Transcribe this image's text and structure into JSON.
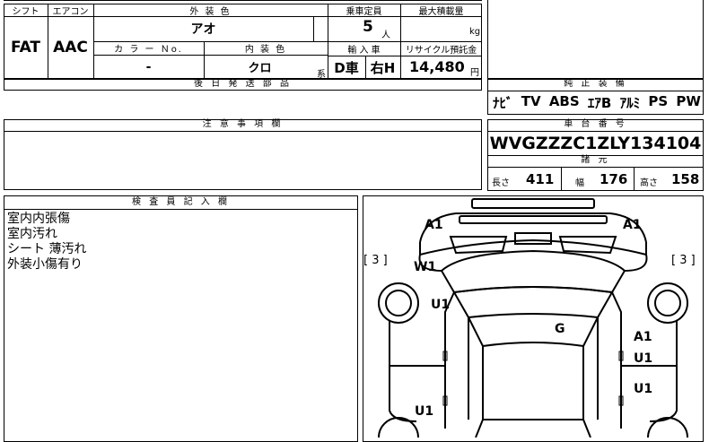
{
  "spec_table": {
    "shift_label": "シフト",
    "shift_value": "FAT",
    "aircon_label": "エアコン",
    "aircon_value": "AAC",
    "exterior_color_label": "外 装 色",
    "exterior_color_value": "アオ",
    "color_no_label": "カ ラ ー Ｎo.",
    "color_no_value": "-",
    "interior_color_label": "内 装 色",
    "interior_color_value": "クロ",
    "interior_suffix": "系",
    "capacity_label": "乗車定員",
    "capacity_value": "5",
    "capacity_unit": "人",
    "max_load_label": "最大積載量",
    "max_load_unit": "kg",
    "import_label": "輸 入 車",
    "import_value": "D車",
    "steering_value": "右H",
    "recycle_label": "リサイクル預託金",
    "recycle_value": "14,480",
    "recycle_unit": "円"
  },
  "later_parts": {
    "label": "後 日 発 送 部 品"
  },
  "genuine_equipment": {
    "label": "純 正 装 備",
    "items": [
      "ﾅﾋﾞ",
      "TV",
      "ABS",
      "ｴｱB",
      "ｱﾙﾐ",
      "PS",
      "PW"
    ]
  },
  "notes_section": {
    "label": "注 意 事 項 欄"
  },
  "chassis": {
    "label": "車 台 番 号",
    "number": "WVGZZZC1ZLY134104",
    "specs_label": "諸 元",
    "length_label": "長さ",
    "length_value": "411",
    "width_label": "幅",
    "width_value": "176",
    "height_label": "高さ",
    "height_value": "158"
  },
  "inspector": {
    "label": "検 査 員 記 入 欄",
    "lines": [
      "室内内張傷",
      "室内汚れ",
      "シート 薄汚れ",
      "外装小傷有り"
    ]
  },
  "diagram": {
    "left_bracket": "[ 3 ]",
    "right_bracket": "[ 3 ]",
    "marks": {
      "a1_front_left": "A1",
      "a1_front_right": "A1",
      "w1": "W1",
      "u1_left_front": "U1",
      "g_roof": "G",
      "a1_right_side": "A1",
      "u1_right_1": "U1",
      "u1_right_2": "U1",
      "u1_left_rear": "U1"
    }
  }
}
